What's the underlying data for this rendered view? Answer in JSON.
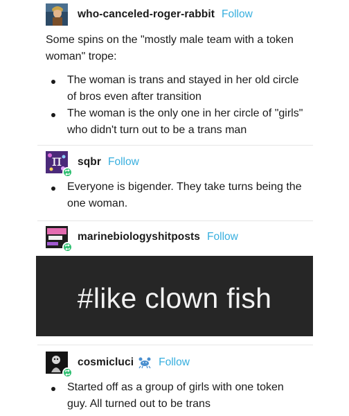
{
  "posts": [
    {
      "username": "who-canceled-roger-rabbit",
      "follow_label": "Follow",
      "intro": [
        "Some spins on the \"mostly male team with a token",
        "woman\" trope:"
      ],
      "bullets": [
        [
          "The woman is trans and stayed in her old circle",
          "of bros even after transition"
        ],
        [
          "The woman is the only one in her circle of \"girls\"",
          "who didn't turn out to be a trans man"
        ]
      ]
    },
    {
      "username": "sqbr",
      "follow_label": "Follow",
      "avatar_symbol": "π",
      "bullets": [
        [
          "Everyone is bigender. They take turns being the",
          "one woman."
        ]
      ]
    },
    {
      "username": "marinebiologyshitposts",
      "follow_label": "Follow",
      "image_text": "#like clown fish"
    },
    {
      "username": "cosmicluci",
      "follow_label": "Follow",
      "bullets": [
        [
          "Started off as a group of girls with one token",
          "guy. All turned out to be trans"
        ]
      ]
    }
  ],
  "colors": {
    "follow": "#36aede",
    "reblog_badge": "#2fbf71",
    "image_background": "#262626"
  },
  "icons": {
    "reblog": "reblog-icon",
    "badge_after_cosmicluci": "crab-icon"
  }
}
